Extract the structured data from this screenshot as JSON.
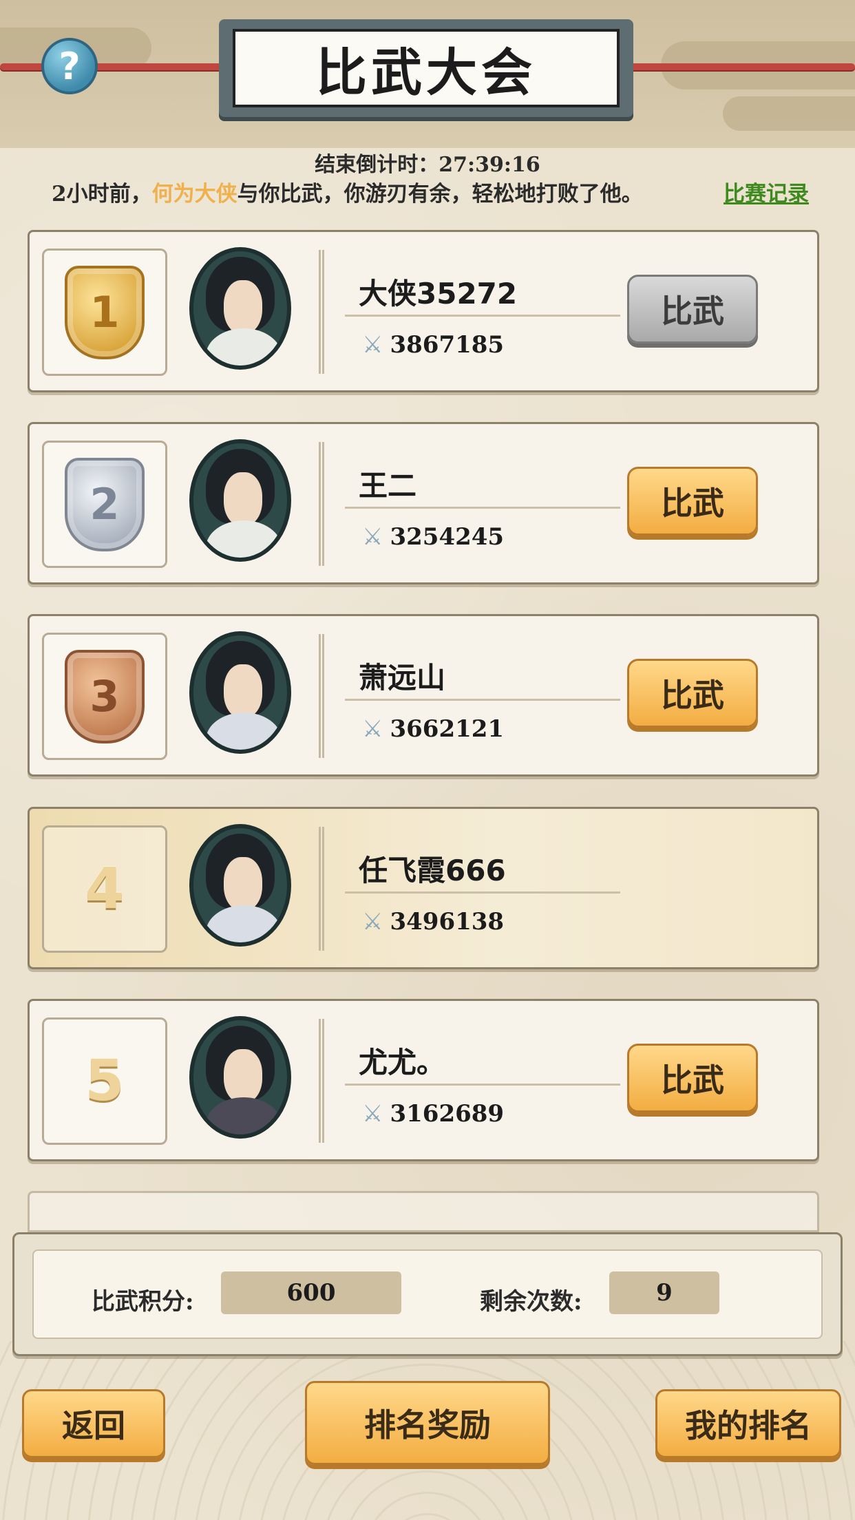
{
  "header": {
    "title": "比武大会",
    "help_icon": "?"
  },
  "countdown": "结束倒计时：27:39:16",
  "battle_log": {
    "prefix": "2小时前，",
    "opponent": "何为大侠",
    "suffix": "与你比武，你游刃有余，轻松地打败了他。",
    "record_link": "比赛记录"
  },
  "colors": {
    "highlight_name": "#f0b04c",
    "record_link": "#3f8a1f",
    "button_orange": "#f3ad42",
    "button_gray": "#a9a9a9"
  },
  "players": [
    {
      "rank": "1",
      "medal": "gold",
      "name": "大侠35272",
      "power": "3867185",
      "button": "比武",
      "button_state": "disabled"
    },
    {
      "rank": "2",
      "medal": "silver",
      "name": "王二",
      "power": "3254245",
      "button": "比武",
      "button_state": "active"
    },
    {
      "rank": "3",
      "medal": "bronze",
      "name": "萧远山",
      "power": "3662121",
      "button": "比武",
      "button_state": "active"
    },
    {
      "rank": "4",
      "medal": "none",
      "name": "任飞霞666",
      "power": "3496138",
      "button": "",
      "button_state": "none"
    },
    {
      "rank": "5",
      "medal": "none",
      "name": "尤尤。",
      "power": "3162689",
      "button": "比武",
      "button_state": "active"
    }
  ],
  "score_panel": {
    "points_label": "比武积分:",
    "points_value": "600",
    "remaining_label": "剩余次数:",
    "remaining_value": "9"
  },
  "footer": {
    "back_label": "返回",
    "rewards_label": "排名奖励",
    "my_rank_label": "我的排名"
  },
  "icons": {
    "power": "crossed-swords-icon",
    "help": "question-icon"
  }
}
